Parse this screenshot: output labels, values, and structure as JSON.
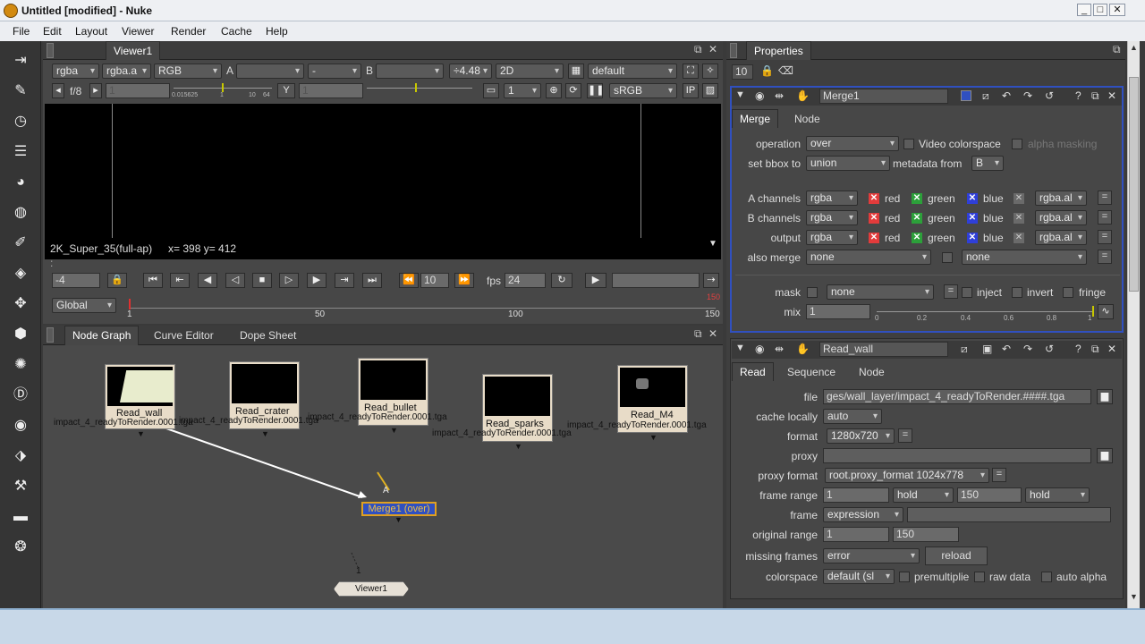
{
  "window": {
    "title": "Untitled [modified] - Nuke",
    "min": "_",
    "max": "□",
    "close": "✕"
  },
  "menu": [
    "File",
    "Edit",
    "Layout",
    "Viewer",
    "Render",
    "Cache",
    "Help"
  ],
  "toolbar_icons": [
    "import-icon",
    "paint-icon",
    "clock-icon",
    "channel-icon",
    "color-wheel-icon",
    "circle-icon",
    "filter-icon",
    "layers-icon",
    "transform-icon",
    "3d-cube-icon",
    "particles-icon",
    "deep-icon",
    "views-icon",
    "metadata-icon",
    "toolsets-icon",
    "other-icon",
    "nuke-logo-icon"
  ],
  "viewer": {
    "tab": "Viewer1",
    "row1": {
      "layer": "rgba",
      "channel": "rgba.a",
      "display": "RGB",
      "a_label": "A",
      "a_input": "",
      "compare": "-",
      "b_label": "B",
      "b_input": "",
      "gamma_ratio": "÷4.48",
      "mode": "2D",
      "lut": "default"
    },
    "row2": {
      "fstop": "f/8",
      "gain": "1",
      "slider_min": "0.015625",
      "slider_mid": "1",
      "slider_ticks": "10",
      "slider_max": "64",
      "y_label": "Y",
      "gamma": "1",
      "proxy": "1",
      "colorspace": "sRGB",
      "ip": "IP"
    },
    "format_label": "2K_Super_35(full-ap)",
    "coords": "x= 398 y= 412",
    "dots": ":",
    "frame": "-4",
    "step": "10",
    "fps_label": "fps",
    "fps": "24",
    "range_mode": "Global",
    "timeline": {
      "start": "1",
      "t50": "50",
      "t100": "100",
      "end": "150",
      "red_mark": "150"
    }
  },
  "nodegraph": {
    "tabs": [
      "Node Graph",
      "Curve Editor",
      "Dope Sheet"
    ],
    "nodes": [
      {
        "name": "Read_wall",
        "file": "impact_4_readyToRender.0001.tga"
      },
      {
        "name": "Read_crater",
        "file": "impact_4_readyToRender.0001.tga"
      },
      {
        "name": "Read_bullet",
        "file": "impact_4_readyToRender.0001.tga"
      },
      {
        "name": "Read_sparks",
        "file": "impact_4_readyToRender.0001.tga"
      },
      {
        "name": "Read_M4",
        "file": "impact_4_readyToRender.0001.tga"
      }
    ],
    "merge": "Merge1 (over)",
    "merge_input_a": "A",
    "viewer_node": "Viewer1",
    "viewer_input": "1"
  },
  "properties": {
    "tab": "Properties",
    "max_panels": "10",
    "merge": {
      "name": "Merge1",
      "tabs": [
        "Merge",
        "Node"
      ],
      "operation_label": "operation",
      "operation": "over",
      "video_colorspace": "Video colorspace",
      "alpha_masking": "alpha masking",
      "bbox_label": "set bbox to",
      "bbox": "union",
      "metadata_label": "metadata from",
      "metadata": "B",
      "channels": [
        {
          "label": "A channels",
          "layer": "rgba",
          "out": "rgba.al"
        },
        {
          "label": "B channels",
          "layer": "rgba",
          "out": "rgba.al"
        },
        {
          "label": "output",
          "layer": "rgba",
          "out": "rgba.al"
        }
      ],
      "red": "red",
      "green": "green",
      "blue": "blue",
      "also_merge_label": "also merge",
      "also_merge": "none",
      "also_merge2": "none",
      "mask_label": "mask",
      "mask": "none",
      "inject": "inject",
      "invert": "invert",
      "fringe": "fringe",
      "mix_label": "mix",
      "mix": "1",
      "mix_ticks": [
        "0",
        "0.2",
        "0.4",
        "0.6",
        "0.8",
        "1"
      ]
    },
    "read": {
      "name": "Read_wall",
      "tabs": [
        "Read",
        "Sequence",
        "Node"
      ],
      "file_label": "file",
      "file": "ges/wall_layer/impact_4_readyToRender.####.tga",
      "cache_label": "cache locally",
      "cache": "auto",
      "format_label": "format",
      "format": "1280x720",
      "proxy_label": "proxy",
      "proxy": "",
      "proxy_format_label": "proxy format",
      "proxy_format": "root.proxy_format 1024x778",
      "frame_range_label": "frame range",
      "first": "1",
      "before": "hold",
      "last": "150",
      "after": "hold",
      "frame_label": "frame",
      "frame_mode": "expression",
      "frame_value": "",
      "original_range_label": "original range",
      "orig_first": "1",
      "orig_last": "150",
      "missing_label": "missing frames",
      "missing": "error",
      "reload": "reload",
      "colorspace_label": "colorspace",
      "colorspace": "default (sl",
      "premultiplied": "premultiplie",
      "raw_data": "raw data",
      "auto_alpha": "auto alpha"
    }
  },
  "colors": {
    "selected_border": "#e0a020",
    "accent_blue": "#3050c0"
  }
}
